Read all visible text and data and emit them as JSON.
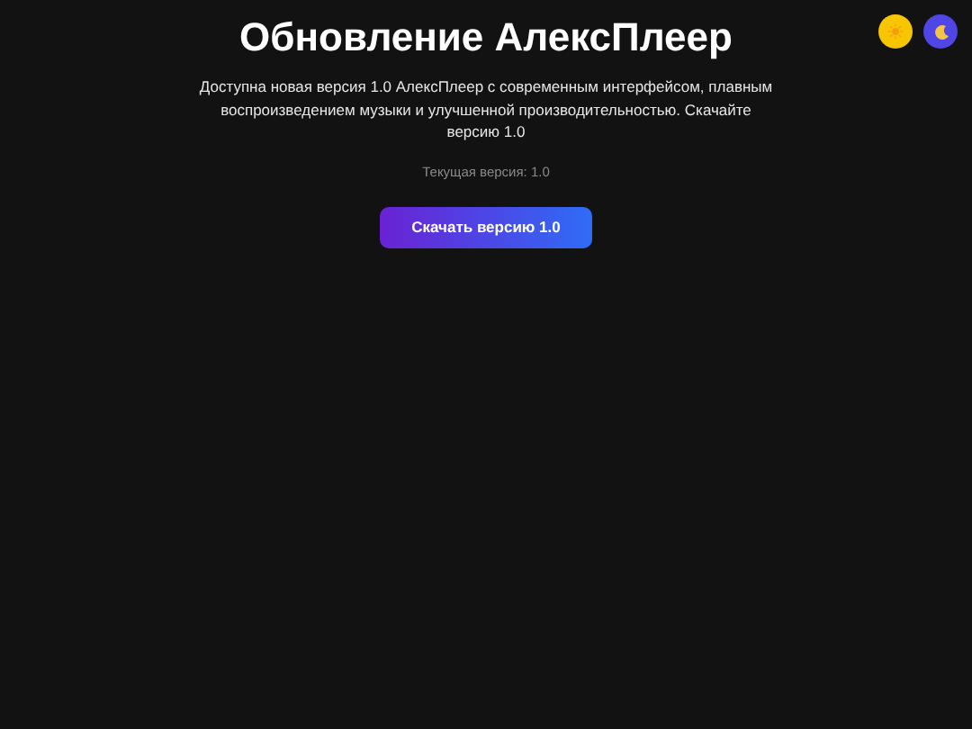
{
  "title": "Обновление АлексПлеер",
  "description": "Доступна новая версия 1.0 АлексПлеер с современным интерфейсом, плавным воспроизведением музыки и улучшенной производительностью. Скачайте версию 1.0",
  "current_version": "Текущая версия: 1.0",
  "download_button": "Скачать версию 1.0",
  "theme_buttons": [
    {
      "kind": "light"
    },
    {
      "kind": "dark"
    }
  ]
}
